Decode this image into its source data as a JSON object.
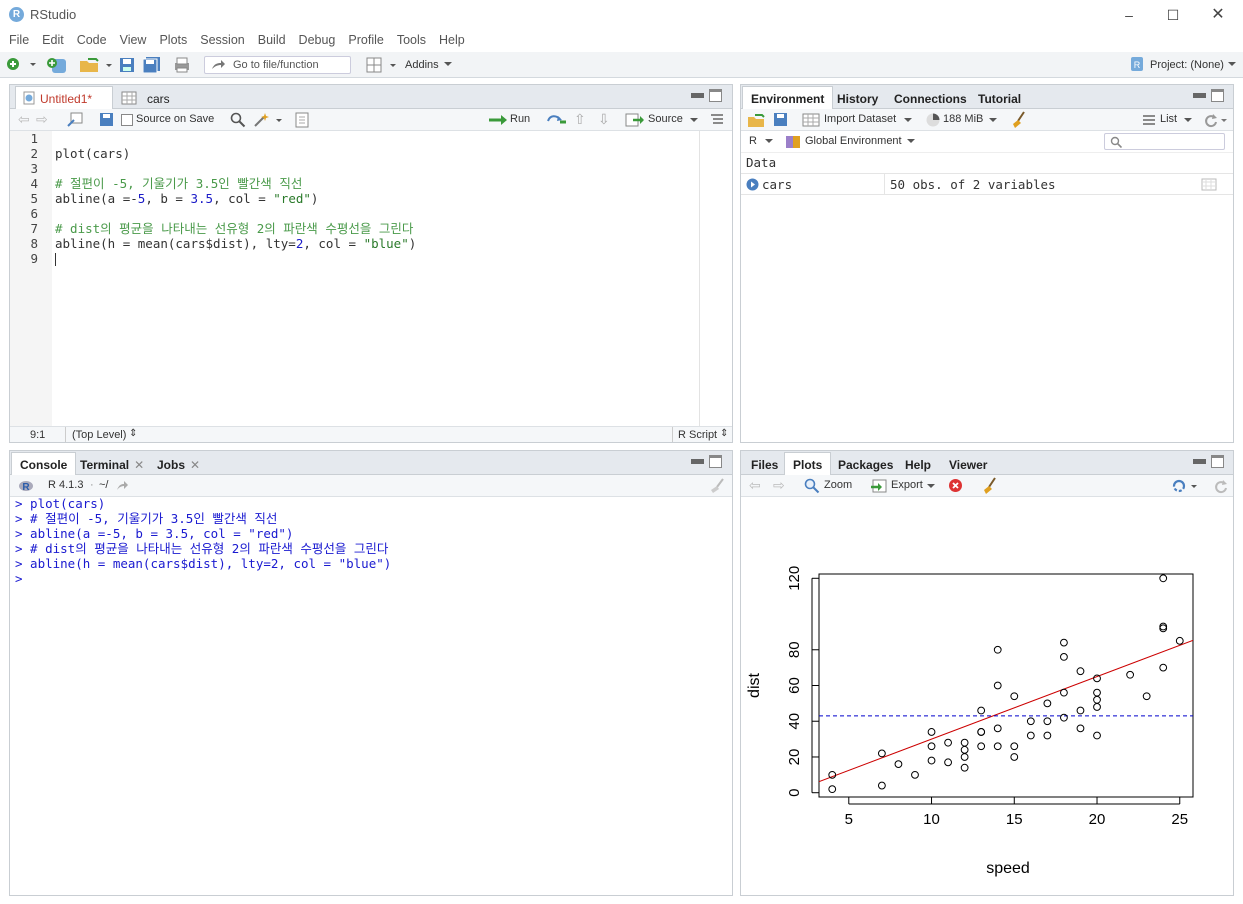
{
  "window": {
    "title": "RStudio",
    "logo": "R"
  },
  "menu": [
    "File",
    "Edit",
    "Code",
    "View",
    "Plots",
    "Session",
    "Build",
    "Debug",
    "Profile",
    "Tools",
    "Help"
  ],
  "toolbar": {
    "goto_placeholder": "Go to file/function",
    "addins": "Addins",
    "project": "Project: (None)"
  },
  "source": {
    "tabs": [
      {
        "label": "Untitled1*"
      },
      {
        "label": "cars"
      }
    ],
    "source_on_save": "Source on Save",
    "run": "Run",
    "source_btn": "Source",
    "line_numbers": [
      "1",
      "2",
      "3",
      "4",
      "5",
      "6",
      "7",
      "8",
      "9"
    ],
    "lines": [
      {
        "parts": []
      },
      {
        "parts": [
          {
            "t": "plot(cars)",
            "c": ""
          }
        ]
      },
      {
        "parts": []
      },
      {
        "parts": [
          {
            "t": "# 절편이 -5, 기울기가 3.5인 빨간색 직선",
            "c": "cm"
          }
        ]
      },
      {
        "parts": [
          {
            "t": "abline(a =-",
            "c": ""
          },
          {
            "t": "5",
            "c": "num"
          },
          {
            "t": ", b = ",
            "c": ""
          },
          {
            "t": "3.5",
            "c": "num"
          },
          {
            "t": ", col = ",
            "c": ""
          },
          {
            "t": "\"red\"",
            "c": "str"
          },
          {
            "t": ")",
            "c": ""
          }
        ]
      },
      {
        "parts": []
      },
      {
        "parts": [
          {
            "t": "# dist의 평균을 나타내는 선유형 2의 파란색 수평선을 그린다",
            "c": "cm"
          }
        ]
      },
      {
        "parts": [
          {
            "t": "abline(h = mean(cars$dist), lty=",
            "c": ""
          },
          {
            "t": "2",
            "c": "num"
          },
          {
            "t": ", col = ",
            "c": ""
          },
          {
            "t": "\"blue\"",
            "c": "str"
          },
          {
            "t": ")",
            "c": ""
          }
        ]
      },
      {
        "parts": []
      }
    ],
    "status_pos": "9:1",
    "status_scope": "(Top Level)",
    "status_type": "R Script"
  },
  "environment": {
    "tabs": [
      {
        "label": "Environment"
      },
      {
        "label": "History"
      },
      {
        "label": "Connections"
      },
      {
        "label": "Tutorial"
      }
    ],
    "import_dataset": "Import Dataset",
    "memory": "188 MiB",
    "list_view": "List",
    "lang": "R",
    "scope": "Global Environment",
    "section": "Data",
    "rows": [
      {
        "name": "cars",
        "value": "50 obs. of 2 variables"
      }
    ]
  },
  "console": {
    "tabs": [
      {
        "label": "Console"
      },
      {
        "label": "Terminal"
      },
      {
        "label": "Jobs"
      }
    ],
    "version": "R 4.1.3",
    "path": "~/",
    "lines": [
      "> plot(cars)",
      "> # 절편이 -5, 기울기가 3.5인 빨간색 직선",
      "> abline(a =-5, b = 3.5, col = \"red\")",
      "> # dist의 평균을 나타내는 선유형 2의 파란색 수평선을 그린다",
      "> abline(h = mean(cars$dist), lty=2, col = \"blue\")",
      "> "
    ]
  },
  "files": {
    "tabs": [
      {
        "label": "Files"
      },
      {
        "label": "Plots"
      },
      {
        "label": "Packages"
      },
      {
        "label": "Help"
      },
      {
        "label": "Viewer"
      }
    ],
    "zoom": "Zoom",
    "export": "Export"
  },
  "chart_data": {
    "type": "scatter",
    "title": "",
    "xlabel": "speed",
    "ylabel": "dist",
    "xlim": [
      3.2,
      25.8
    ],
    "ylim": [
      -2.4,
      122.4
    ],
    "x_ticks": [
      5,
      10,
      15,
      20,
      25
    ],
    "y_ticks": [
      0,
      20,
      40,
      60,
      80,
      120
    ],
    "x": [
      4,
      4,
      7,
      7,
      8,
      9,
      10,
      10,
      10,
      11,
      11,
      12,
      12,
      12,
      12,
      13,
      13,
      13,
      13,
      14,
      14,
      14,
      14,
      15,
      15,
      15,
      16,
      16,
      17,
      17,
      17,
      18,
      18,
      18,
      18,
      19,
      19,
      19,
      20,
      20,
      20,
      20,
      20,
      22,
      23,
      24,
      24,
      24,
      24,
      25
    ],
    "y": [
      2,
      10,
      4,
      22,
      16,
      10,
      18,
      26,
      34,
      17,
      28,
      14,
      20,
      24,
      28,
      26,
      34,
      34,
      46,
      26,
      36,
      60,
      80,
      20,
      26,
      54,
      32,
      40,
      32,
      40,
      50,
      42,
      56,
      76,
      84,
      36,
      46,
      68,
      32,
      48,
      52,
      56,
      64,
      66,
      54,
      70,
      92,
      93,
      120,
      85
    ],
    "lines": [
      {
        "kind": "abline",
        "intercept": -5,
        "slope": 3.5,
        "color": "#cc0000",
        "style": "solid"
      },
      {
        "kind": "hline",
        "y": 42.98,
        "color": "#0000cc",
        "style": "dashed"
      }
    ]
  }
}
